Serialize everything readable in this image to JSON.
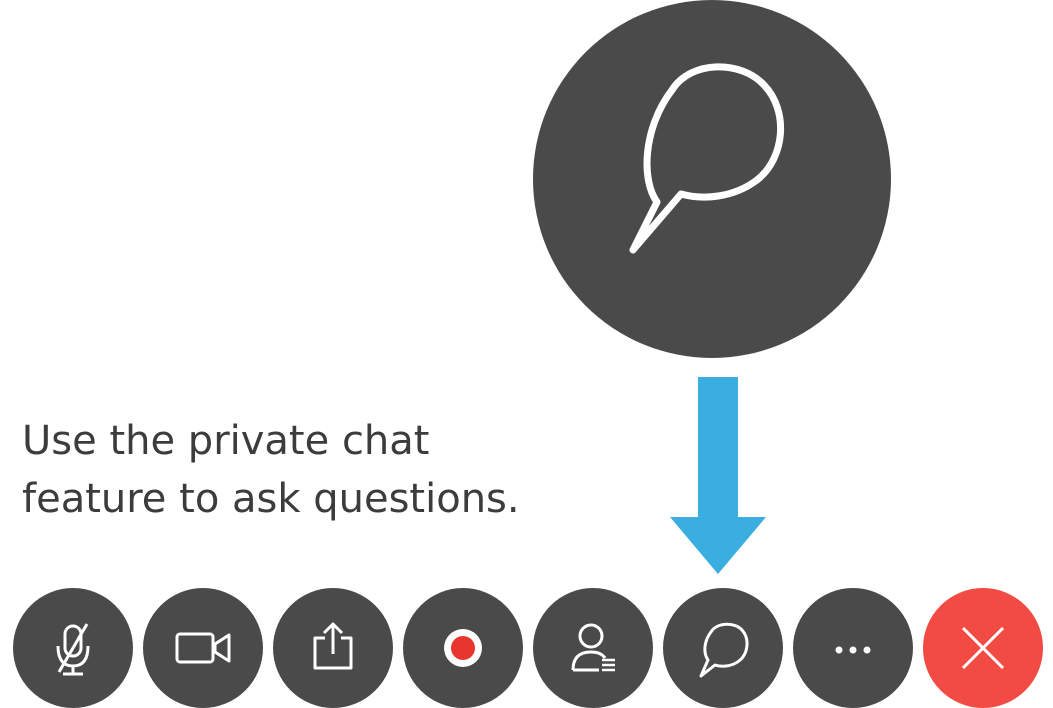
{
  "caption": {
    "line1": "Use the private chat",
    "line2": "feature to ask questions."
  },
  "callout": {
    "icon": "chat-bubble-icon",
    "arrow_color": "#3aaee0"
  },
  "toolbar": {
    "buttons": [
      {
        "name": "mute-button",
        "icon": "microphone-muted-icon"
      },
      {
        "name": "video-button",
        "icon": "video-camera-icon"
      },
      {
        "name": "share-button",
        "icon": "share-upload-icon"
      },
      {
        "name": "record-button",
        "icon": "record-icon"
      },
      {
        "name": "participants-button",
        "icon": "participants-icon"
      },
      {
        "name": "chat-button",
        "icon": "chat-bubble-icon"
      },
      {
        "name": "more-options-button",
        "icon": "more-dots-icon"
      },
      {
        "name": "end-meeting-button",
        "icon": "close-x-icon"
      }
    ]
  },
  "colors": {
    "button_bg": "#4a4a4a",
    "end_button_bg": "#f24b44",
    "record_dot": "#e8352f",
    "arrow": "#3aaee0",
    "text": "#3c3c3c"
  }
}
